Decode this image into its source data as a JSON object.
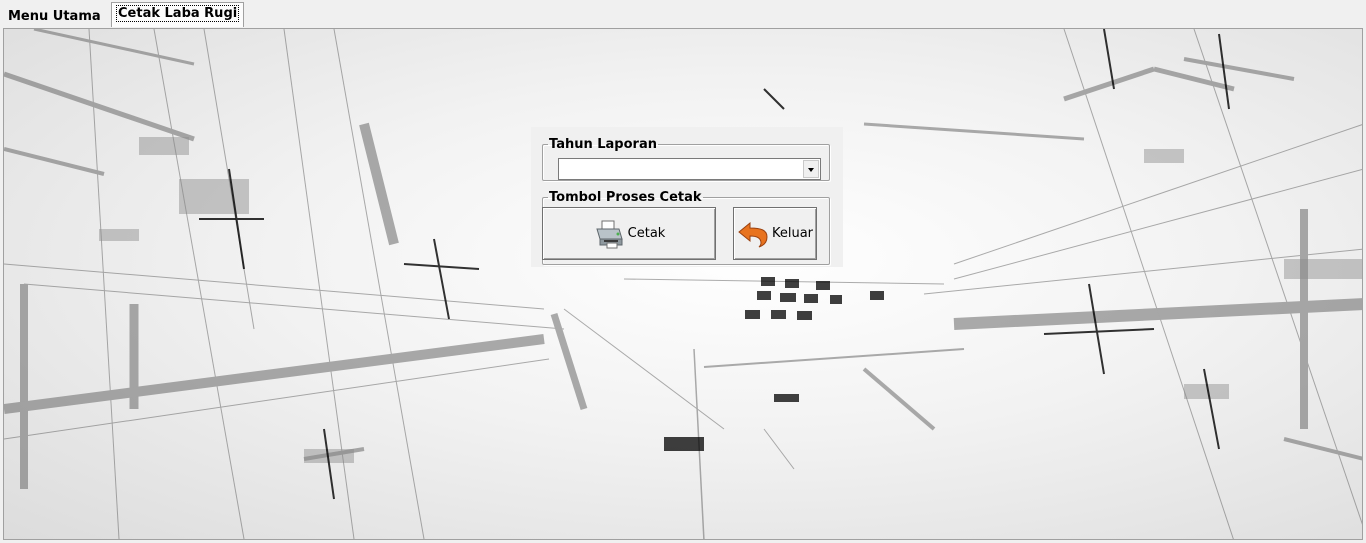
{
  "tabs": [
    {
      "label": "Menu Utama",
      "active": false
    },
    {
      "label": "Cetak Laba Rugi",
      "active": true
    }
  ],
  "dialog": {
    "tahun_group_label": "Tahun Laporan",
    "tahun_value": "",
    "proses_group_label": "Tombol Proses Cetak",
    "cetak_label": "Cetak",
    "keluar_label": "Keluar"
  },
  "icons": {
    "cetak": "printer-icon",
    "keluar": "back-arrow-icon"
  },
  "colors": {
    "keluar_icon": "#e8731f",
    "background": "#f0f0f0"
  }
}
